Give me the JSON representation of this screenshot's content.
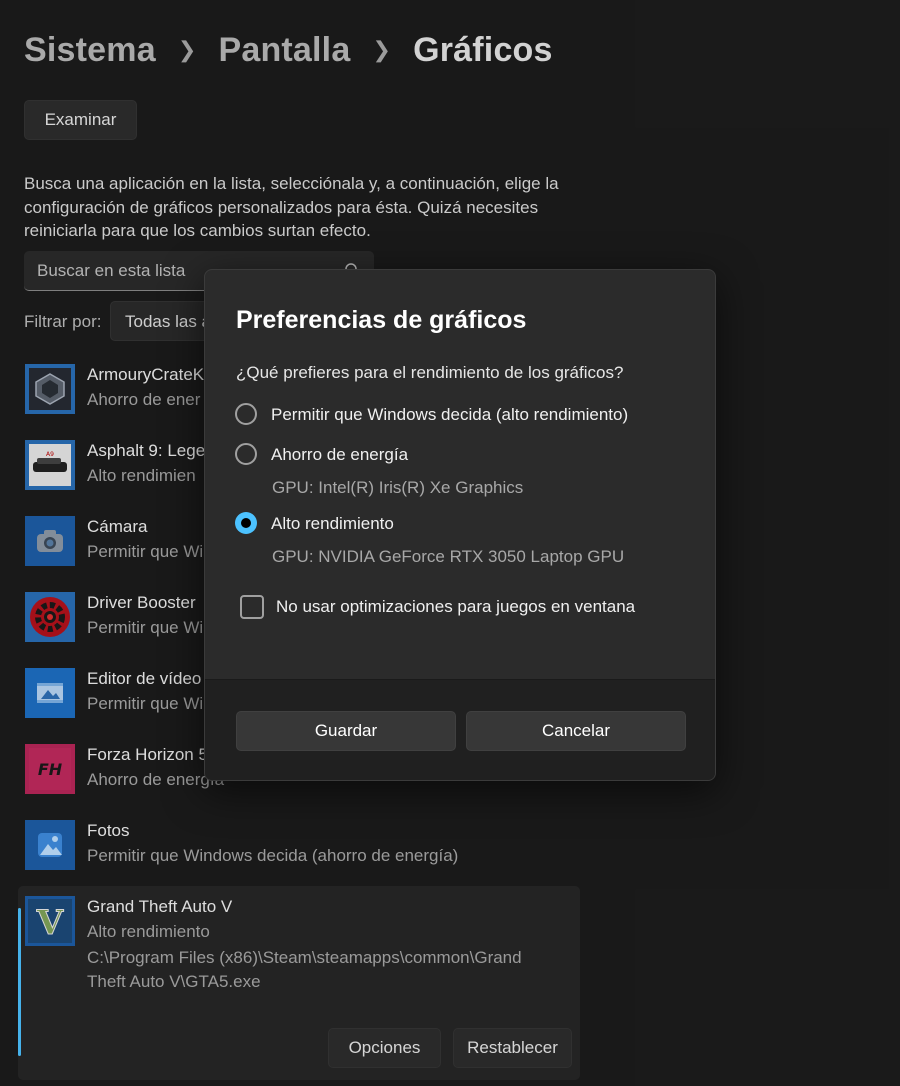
{
  "breadcrumb": {
    "items": [
      "Sistema",
      "Pantalla",
      "Gráficos"
    ]
  },
  "browse_button": "Examinar",
  "description": "Busca una aplicación en la lista, selecciónala y, a continuación, elige la configuración de gráficos personalizados para ésta. Quizá necesites reiniciarla para que los cambios surtan efecto.",
  "search": {
    "placeholder": "Buscar en esta lista",
    "icon": "search-icon"
  },
  "filter": {
    "label": "Filtrar por:",
    "value": "Todas las a"
  },
  "apps": [
    {
      "name": "ArmouryCrateK",
      "pref": "Ahorro de ener"
    },
    {
      "name": "Asphalt 9: Lege",
      "pref": "Alto rendimien"
    },
    {
      "name": "Cámara",
      "pref": "Permitir que Wi"
    },
    {
      "name": "Driver Booster",
      "pref": "Permitir que Wi"
    },
    {
      "name": "Editor de vídeo",
      "pref": "Permitir que Wi"
    },
    {
      "name": "Forza Horizon 5",
      "pref": "Ahorro de energía"
    },
    {
      "name": "Fotos",
      "pref": "Permitir que Windows decida (ahorro de energía)"
    },
    {
      "name": "Grand Theft Auto V",
      "pref": "Alto rendimiento",
      "path": "C:\\Program Files (x86)\\Steam\\steamapps\\common\\Grand Theft Auto V\\GTA5.exe"
    }
  ],
  "selected_actions": {
    "options": "Opciones",
    "reset": "Restablecer"
  },
  "dialog": {
    "title": "Preferencias de gráficos",
    "question": "¿Qué prefieres para el rendimiento de los gráficos?",
    "options": [
      {
        "label": "Permitir que Windows decida (alto rendimiento)",
        "checked": false
      },
      {
        "label": "Ahorro de energía",
        "gpu": "GPU: Intel(R) Iris(R) Xe Graphics",
        "checked": false
      },
      {
        "label": "Alto rendimiento",
        "gpu": "GPU: NVIDIA GeForce RTX 3050 Laptop GPU",
        "checked": true
      }
    ],
    "checkbox_label": "No usar optimizaciones para juegos en ventana",
    "save": "Guardar",
    "cancel": "Cancelar"
  },
  "colors": {
    "accent": "#4cc2ff",
    "background": "#1c1c1c",
    "dialog": "#2b2b2b"
  }
}
